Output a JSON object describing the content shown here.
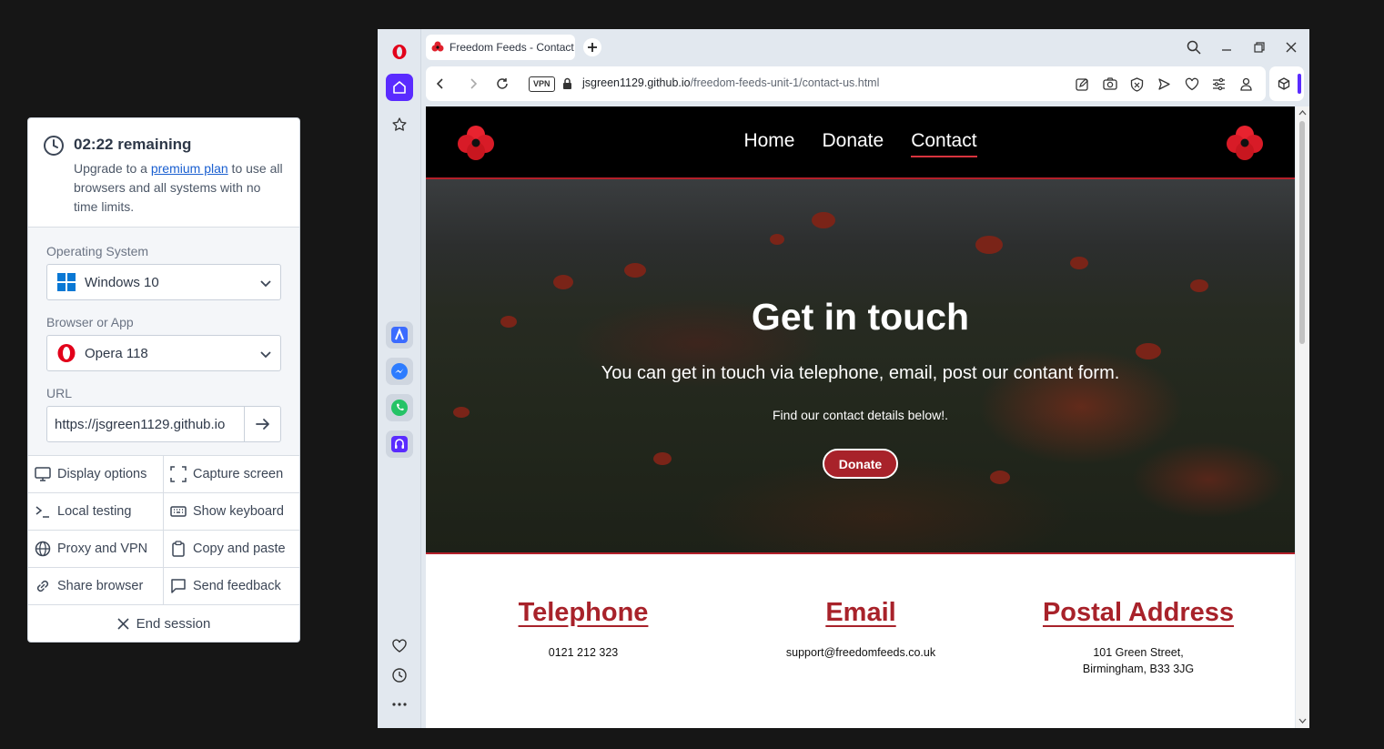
{
  "panel": {
    "timer": {
      "remaining": "02:22 remaining",
      "upgrade_prefix": "Upgrade to a ",
      "upgrade_link": "premium plan",
      "upgrade_suffix": " to use all browsers and all systems with no time limits."
    },
    "os_label": "Operating System",
    "os_value": "Windows 10",
    "browser_label": "Browser or App",
    "browser_value": "Opera 118",
    "url_label": "URL",
    "url_value": "https://jsgreen1129.github.io",
    "actions": [
      {
        "label": "Display options",
        "icon": "monitor-icon"
      },
      {
        "label": "Capture screen",
        "icon": "capture-icon"
      },
      {
        "label": "Local testing",
        "icon": "terminal-icon"
      },
      {
        "label": "Show keyboard",
        "icon": "keyboard-icon"
      },
      {
        "label": "Proxy and VPN",
        "icon": "globe-icon"
      },
      {
        "label": "Copy and paste",
        "icon": "clipboard-icon"
      },
      {
        "label": "Share browser",
        "icon": "link-icon"
      },
      {
        "label": "Send feedback",
        "icon": "chat-icon"
      }
    ],
    "end_session": "End session"
  },
  "browser": {
    "tab_title": "Freedom Feeds - Contact",
    "vpn_badge": "VPN",
    "url_host": "jsgreen1129.github.io",
    "url_path": "/freedom-feeds-unit-1/contact-us.html"
  },
  "site": {
    "nav": [
      "Home",
      "Donate",
      "Contact"
    ],
    "active_nav": "Contact",
    "hero_title": "Get in touch",
    "hero_sub": "You can get in touch via telephone, email, post our contant form.",
    "hero_small": "Find our contact details below!.",
    "hero_button": "Donate",
    "telephone_title": "Telephone",
    "telephone_value": "0121 212 323",
    "email_title": "Email",
    "email_value": "support@freedomfeeds.co.uk",
    "address_title": "Postal Address",
    "address_line1": "101 Green Street,",
    "address_line2": "Birmingham, B33 3JG"
  },
  "colors": {
    "accent_red": "#a8222a",
    "link_blue": "#1a5fd0",
    "opera_red": "#e2001a",
    "sidebar_active": "#5a2bff"
  }
}
